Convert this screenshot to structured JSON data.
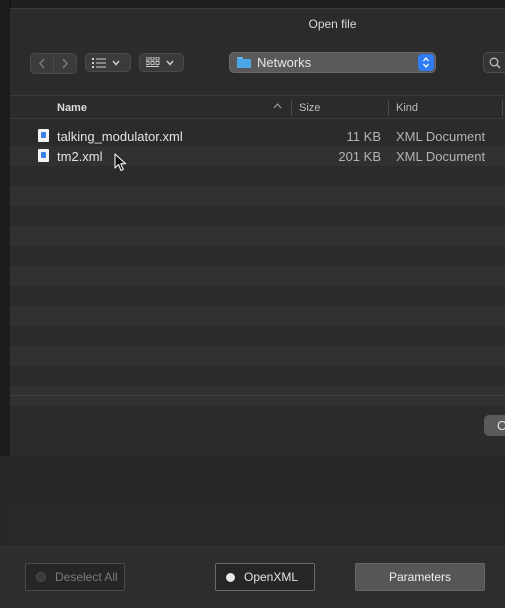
{
  "dialog": {
    "title": "Open file",
    "location": "Networks",
    "cancel_label": "C"
  },
  "toolbar": {
    "back_icon": "chevron-left-icon",
    "forward_icon": "chevron-right-icon",
    "list_view_icon": "list-view-icon",
    "grid_view_icon": "grid-view-icon",
    "search_icon": "search-icon"
  },
  "file_list": {
    "columns": [
      "Name",
      "Size",
      "Kind"
    ],
    "rows": [
      {
        "name": "talking_modulator.xml",
        "size": "11 KB",
        "kind": "XML Document"
      },
      {
        "name": "tm2.xml",
        "size": "201 KB",
        "kind": "XML Document"
      }
    ]
  },
  "bottom_bar": {
    "deselect_label": "Deselect All",
    "openxml_label": "OpenXML",
    "parameters_label": "Parameters"
  },
  "colors": {
    "accent": "#2f7cf6",
    "folder": "#4aa6e6",
    "background": "#2b2b2b"
  }
}
